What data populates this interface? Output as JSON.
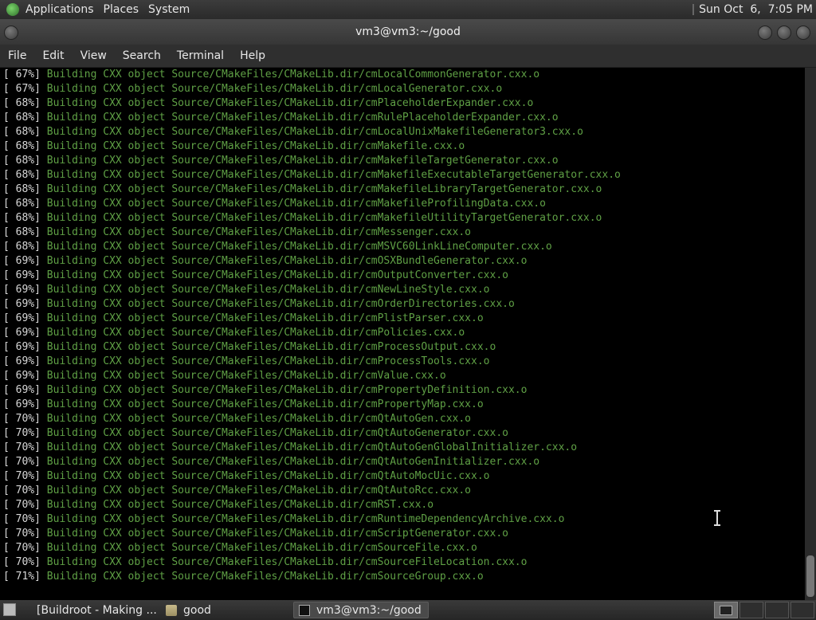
{
  "top_panel": {
    "menus": [
      "Applications",
      "Places",
      "System"
    ],
    "clock": "Sun Oct  6,  7:05 PM"
  },
  "window": {
    "title": "vm3@vm3:~/good"
  },
  "menubar": [
    "File",
    "Edit",
    "View",
    "Search",
    "Terminal",
    "Help"
  ],
  "terminal": {
    "lines": [
      {
        "pct": "[ 67%]",
        "msg": "Building CXX object Source/CMakeFiles/CMakeLib.dir/cmLocalCommonGenerator.cxx.o"
      },
      {
        "pct": "[ 67%]",
        "msg": "Building CXX object Source/CMakeFiles/CMakeLib.dir/cmLocalGenerator.cxx.o"
      },
      {
        "pct": "[ 68%]",
        "msg": "Building CXX object Source/CMakeFiles/CMakeLib.dir/cmPlaceholderExpander.cxx.o"
      },
      {
        "pct": "[ 68%]",
        "msg": "Building CXX object Source/CMakeFiles/CMakeLib.dir/cmRulePlaceholderExpander.cxx.o"
      },
      {
        "pct": "[ 68%]",
        "msg": "Building CXX object Source/CMakeFiles/CMakeLib.dir/cmLocalUnixMakefileGenerator3.cxx.o"
      },
      {
        "pct": "[ 68%]",
        "msg": "Building CXX object Source/CMakeFiles/CMakeLib.dir/cmMakefile.cxx.o"
      },
      {
        "pct": "[ 68%]",
        "msg": "Building CXX object Source/CMakeFiles/CMakeLib.dir/cmMakefileTargetGenerator.cxx.o"
      },
      {
        "pct": "[ 68%]",
        "msg": "Building CXX object Source/CMakeFiles/CMakeLib.dir/cmMakefileExecutableTargetGenerator.cxx.o"
      },
      {
        "pct": "[ 68%]",
        "msg": "Building CXX object Source/CMakeFiles/CMakeLib.dir/cmMakefileLibraryTargetGenerator.cxx.o"
      },
      {
        "pct": "[ 68%]",
        "msg": "Building CXX object Source/CMakeFiles/CMakeLib.dir/cmMakefileProfilingData.cxx.o"
      },
      {
        "pct": "[ 68%]",
        "msg": "Building CXX object Source/CMakeFiles/CMakeLib.dir/cmMakefileUtilityTargetGenerator.cxx.o"
      },
      {
        "pct": "[ 68%]",
        "msg": "Building CXX object Source/CMakeFiles/CMakeLib.dir/cmMessenger.cxx.o"
      },
      {
        "pct": "[ 68%]",
        "msg": "Building CXX object Source/CMakeFiles/CMakeLib.dir/cmMSVC60LinkLineComputer.cxx.o"
      },
      {
        "pct": "[ 69%]",
        "msg": "Building CXX object Source/CMakeFiles/CMakeLib.dir/cmOSXBundleGenerator.cxx.o"
      },
      {
        "pct": "[ 69%]",
        "msg": "Building CXX object Source/CMakeFiles/CMakeLib.dir/cmOutputConverter.cxx.o"
      },
      {
        "pct": "[ 69%]",
        "msg": "Building CXX object Source/CMakeFiles/CMakeLib.dir/cmNewLineStyle.cxx.o"
      },
      {
        "pct": "[ 69%]",
        "msg": "Building CXX object Source/CMakeFiles/CMakeLib.dir/cmOrderDirectories.cxx.o"
      },
      {
        "pct": "[ 69%]",
        "msg": "Building CXX object Source/CMakeFiles/CMakeLib.dir/cmPlistParser.cxx.o"
      },
      {
        "pct": "[ 69%]",
        "msg": "Building CXX object Source/CMakeFiles/CMakeLib.dir/cmPolicies.cxx.o"
      },
      {
        "pct": "[ 69%]",
        "msg": "Building CXX object Source/CMakeFiles/CMakeLib.dir/cmProcessOutput.cxx.o"
      },
      {
        "pct": "[ 69%]",
        "msg": "Building CXX object Source/CMakeFiles/CMakeLib.dir/cmProcessTools.cxx.o"
      },
      {
        "pct": "[ 69%]",
        "msg": "Building CXX object Source/CMakeFiles/CMakeLib.dir/cmValue.cxx.o"
      },
      {
        "pct": "[ 69%]",
        "msg": "Building CXX object Source/CMakeFiles/CMakeLib.dir/cmPropertyDefinition.cxx.o"
      },
      {
        "pct": "[ 69%]",
        "msg": "Building CXX object Source/CMakeFiles/CMakeLib.dir/cmPropertyMap.cxx.o"
      },
      {
        "pct": "[ 70%]",
        "msg": "Building CXX object Source/CMakeFiles/CMakeLib.dir/cmQtAutoGen.cxx.o"
      },
      {
        "pct": "[ 70%]",
        "msg": "Building CXX object Source/CMakeFiles/CMakeLib.dir/cmQtAutoGenerator.cxx.o"
      },
      {
        "pct": "[ 70%]",
        "msg": "Building CXX object Source/CMakeFiles/CMakeLib.dir/cmQtAutoGenGlobalInitializer.cxx.o"
      },
      {
        "pct": "[ 70%]",
        "msg": "Building CXX object Source/CMakeFiles/CMakeLib.dir/cmQtAutoGenInitializer.cxx.o"
      },
      {
        "pct": "[ 70%]",
        "msg": "Building CXX object Source/CMakeFiles/CMakeLib.dir/cmQtAutoMocUic.cxx.o"
      },
      {
        "pct": "[ 70%]",
        "msg": "Building CXX object Source/CMakeFiles/CMakeLib.dir/cmQtAutoRcc.cxx.o"
      },
      {
        "pct": "[ 70%]",
        "msg": "Building CXX object Source/CMakeFiles/CMakeLib.dir/cmRST.cxx.o"
      },
      {
        "pct": "[ 70%]",
        "msg": "Building CXX object Source/CMakeFiles/CMakeLib.dir/cmRuntimeDependencyArchive.cxx.o"
      },
      {
        "pct": "[ 70%]",
        "msg": "Building CXX object Source/CMakeFiles/CMakeLib.dir/cmScriptGenerator.cxx.o"
      },
      {
        "pct": "[ 70%]",
        "msg": "Building CXX object Source/CMakeFiles/CMakeLib.dir/cmSourceFile.cxx.o"
      },
      {
        "pct": "[ 70%]",
        "msg": "Building CXX object Source/CMakeFiles/CMakeLib.dir/cmSourceFileLocation.cxx.o"
      },
      {
        "pct": "[ 71%]",
        "msg": "Building CXX object Source/CMakeFiles/CMakeLib.dir/cmSourceGroup.cxx.o"
      }
    ]
  },
  "taskbar": {
    "tasks": [
      "[Buildroot - Making ...",
      "good",
      "vm3@vm3:~/good"
    ]
  },
  "colors": {
    "terminal_bg": "#000000",
    "build_text": "#5fa045",
    "percent_text": "#d8d8d8"
  }
}
